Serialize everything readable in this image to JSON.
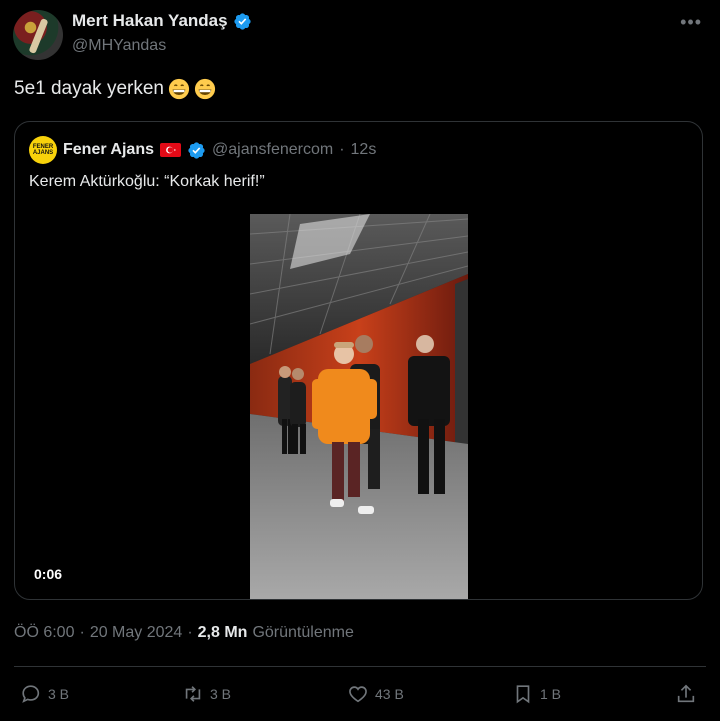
{
  "author": {
    "display_name": "Mert Hakan Yandaş",
    "handle": "@MHYandas"
  },
  "tweet": {
    "text": "5e1 dayak yerken"
  },
  "quoted": {
    "display_name": "Fener Ajans",
    "handle": "@ajansfenercom",
    "separator": "·",
    "time": "12s",
    "text": "Kerem Aktürkoğlu: “Korkak herif!”",
    "video_duration": "0:06",
    "avatar_text": "FENER AJANS"
  },
  "meta": {
    "time": "ÖÖ 6:00",
    "dot1": "·",
    "date": "20 May 2024",
    "dot2": "·",
    "views_count": "2,8 Mn",
    "views_label": "Görüntülenme"
  },
  "actions": {
    "replies": "3 B",
    "reposts": "3 B",
    "likes": "43 B",
    "bookmarks": "1 B"
  },
  "colors": {
    "verified": "#1d9bf0",
    "background": "#000000",
    "muted": "#71767b"
  }
}
